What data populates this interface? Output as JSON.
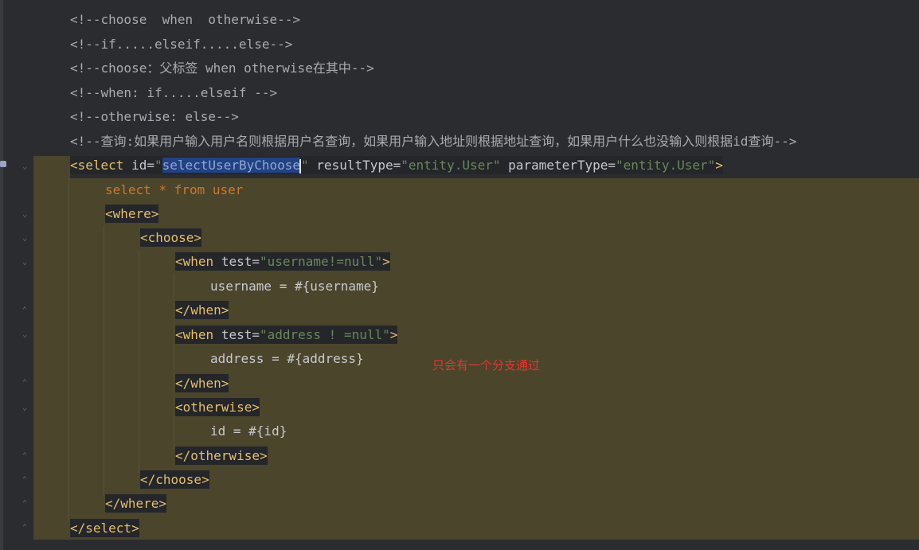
{
  "comments": [
    "<!--choose  when  otherwise-->",
    "<!--if.....elseif.....else-->",
    "<!--choose：父标签 when otherwise在其中-->",
    "<!--when: if.....elseif -->",
    "<!--otherwise: else-->",
    "<!--查询:如果用户输入用户名则根据用户名查询，如果用户输入地址则根据地址查询，如果用户什么也没输入则根据id查询-->"
  ],
  "select": {
    "open_tag": "<select",
    "id_attr": "id",
    "id_value_selected": "selectUserByChoose",
    "result_attr": "resultType",
    "result_value": "\"entity.User\"",
    "param_attr": "parameterType",
    "param_value": "\"entity.User\"",
    "close_bracket": ">",
    "close_tag": "</select>"
  },
  "sql": {
    "select_kw": "select",
    "star": "*",
    "from_kw": "from",
    "table": "user"
  },
  "where": {
    "open": "<where>",
    "close": "</where>"
  },
  "choose": {
    "open": "<choose>",
    "close": "</choose>"
  },
  "when1": {
    "open_prefix": "<when",
    "test_attr": "test",
    "test_value": "\"username!=null\"",
    "open_suffix": ">",
    "body": "username = #{username}",
    "close": "</when>"
  },
  "when2": {
    "open_prefix": "<when",
    "test_attr": "test",
    "test_value": "\"address ! =null\"",
    "open_suffix": ">",
    "body": "address = #{address}",
    "close": "</when>"
  },
  "otherwise": {
    "open": "<otherwise>",
    "body": "id = #{id}",
    "close": "</otherwise>"
  },
  "annotation": "只会有一个分支通过",
  "colors": {
    "background": "#2b2c2f",
    "highlight": "#4a452b",
    "tag": "#e8bf6a",
    "string": "#6a8759",
    "keyword": "#cc7832",
    "selection": "#214283",
    "annotation": "#e8352f"
  }
}
